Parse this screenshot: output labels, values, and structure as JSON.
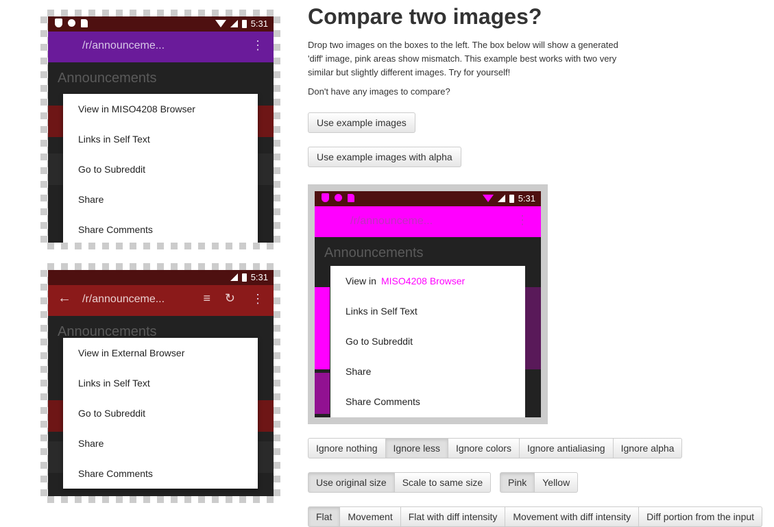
{
  "page": {
    "heading": "Compare two images?",
    "description": "Drop two images on the boxes to the left. The box below will show a generated 'diff' image, pink areas show mismatch. This example best works with two very similar but slightly different images. Try for yourself!",
    "no_images_prompt": "Don't have any images to compare?",
    "use_example_label": "Use example images",
    "use_example_alpha_label": "Use example images with alpha"
  },
  "phone_a": {
    "time": "5:31",
    "app_title": "/r/announceme...",
    "feed_title": "Announcements",
    "menu": [
      "View in MISO4208 Browser",
      "Links in Self Text",
      "Go to Subreddit",
      "Share",
      "Share Comments"
    ]
  },
  "phone_b": {
    "time": "5:31",
    "app_title": "/r/announceme...",
    "feed_title": "Announcements",
    "menu": [
      "View in External Browser",
      "Links in Self Text",
      "Go to Subreddit",
      "Share",
      "Share Comments"
    ]
  },
  "diff": {
    "time": "5:31",
    "app_title": "/r/announceme...",
    "feed_title": "Announcements",
    "menu_prefix": "View in",
    "menu_overlay": "MISO4208 Browser",
    "menu": [
      "Links in Self Text",
      "Go to Subreddit",
      "Share",
      "Share Comments"
    ],
    "highlight_color": "#ff00ff"
  },
  "ignore_group": {
    "options": [
      "Ignore nothing",
      "Ignore less",
      "Ignore colors",
      "Ignore antialiasing",
      "Ignore alpha"
    ],
    "selected": "Ignore less"
  },
  "size_group": {
    "options": [
      "Use original size",
      "Scale to same size"
    ],
    "selected": "Use original size"
  },
  "color_group": {
    "options": [
      "Pink",
      "Yellow"
    ],
    "selected": "Pink"
  },
  "mode_group": {
    "options": [
      "Flat",
      "Movement",
      "Flat with diff intensity",
      "Movement with diff intensity",
      "Diff portion from the input"
    ],
    "selected": "Flat"
  }
}
